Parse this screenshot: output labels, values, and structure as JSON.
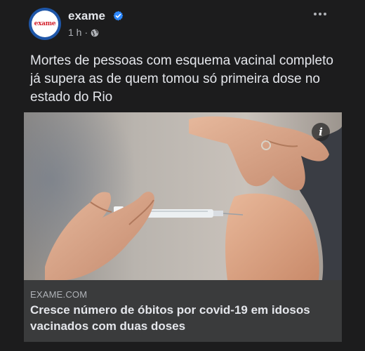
{
  "post": {
    "page_name": "exame",
    "avatar_logo_text": "exame",
    "time": "1 h",
    "separator": "·",
    "privacy_icon": "globe-icon",
    "verified_icon": "verified-badge-icon",
    "more_icon": "more-options-icon",
    "caption": "Mortes de pessoas com esquema vacinal completo já supera as de quem tomou só primeira dose no estado do Rio"
  },
  "link_preview": {
    "domain": "EXAME.COM",
    "headline": "Cresce número de óbitos por covid-19 em idosos vacinados com duas doses",
    "info_icon": "info-icon",
    "image_subject": "vaccine-injection-photo"
  },
  "colors": {
    "background": "#1c1c1d",
    "link_box": "#3a3b3c",
    "verified_blue": "#2d88ff",
    "brand_red": "#d31f2b",
    "brand_blue": "#1e56a8"
  }
}
